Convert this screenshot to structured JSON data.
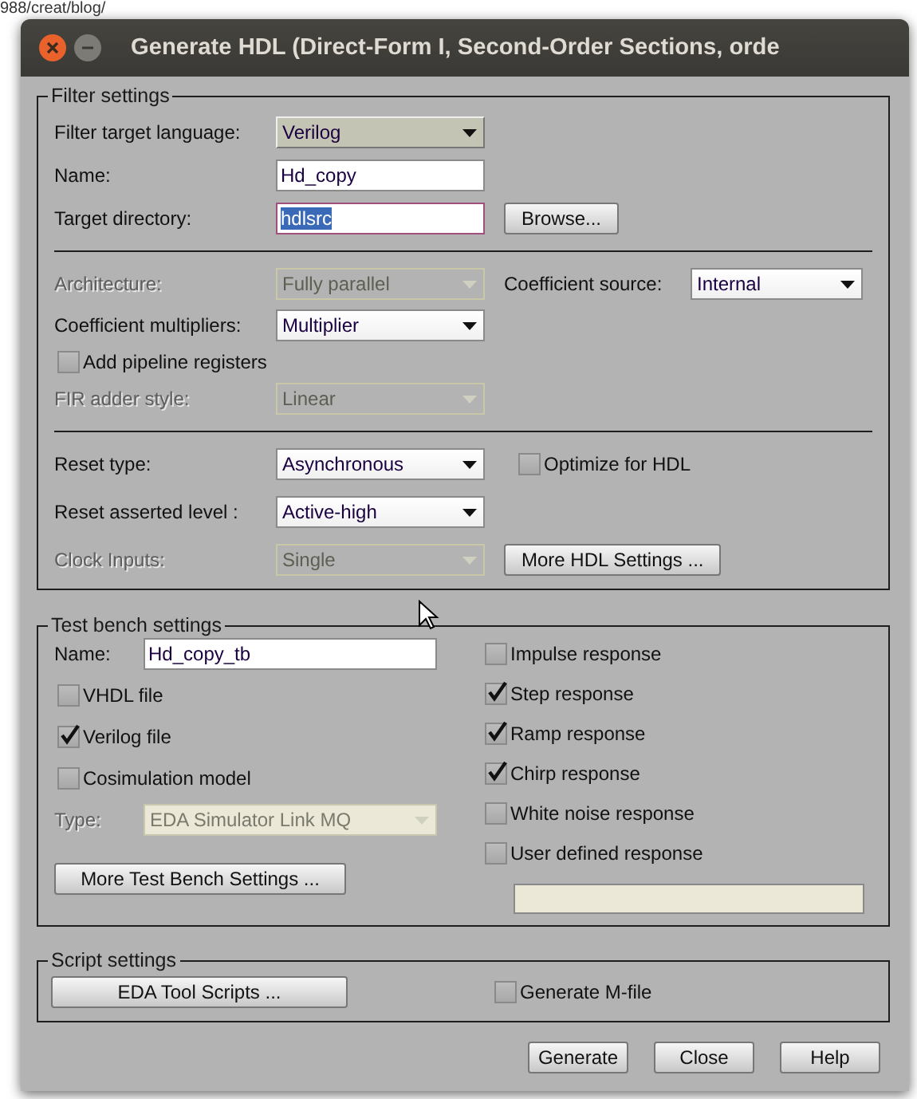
{
  "background": {
    "address_fragment": "988/creat/blog/"
  },
  "window": {
    "title": "Generate HDL (Direct-Form I, Second-Order Sections, orde"
  },
  "filter_settings": {
    "legend": "Filter settings",
    "sections": [
      {
        "rows": [
          {
            "items": [
              {
                "kind": "label",
                "text": "Filter target language:",
                "disabled": false
              },
              {
                "kind": "dropdown",
                "value": "Verilog",
                "disabled": false,
                "focused": true
              }
            ]
          },
          {
            "items": [
              {
                "kind": "label",
                "text": "Name:",
                "disabled": false
              },
              {
                "kind": "input",
                "value": "Hd_copy",
                "focused": false,
                "text_selected": false,
                "disabled": false
              }
            ]
          },
          {
            "items": [
              {
                "kind": "label",
                "text": "Target directory:",
                "disabled": false
              },
              {
                "kind": "input",
                "value": "hdlsrc",
                "focused": true,
                "text_selected": true,
                "disabled": false
              },
              {
                "kind": "button",
                "label": "Browse..."
              }
            ]
          }
        ]
      },
      {
        "rows": [
          {
            "items": [
              {
                "kind": "label",
                "text": "Architecture:",
                "disabled": true
              },
              {
                "kind": "dropdown",
                "value": "Fully parallel",
                "disabled": true,
                "focused": false
              },
              {
                "kind": "label",
                "text": "Coefficient source:",
                "disabled": false
              },
              {
                "kind": "dropdown",
                "value": "Internal",
                "disabled": false,
                "focused": false
              }
            ]
          },
          {
            "items": [
              {
                "kind": "label",
                "text": "Coefficient multipliers:",
                "disabled": false
              },
              {
                "kind": "dropdown",
                "value": "Multiplier",
                "disabled": false,
                "focused": false
              }
            ]
          },
          {
            "items": [
              {
                "kind": "checkbox",
                "label": "Add pipeline registers",
                "checked": false
              }
            ]
          },
          {
            "items": [
              {
                "kind": "label",
                "text": "FIR adder style:",
                "disabled": true
              },
              {
                "kind": "dropdown",
                "value": "Linear",
                "disabled": true,
                "focused": false
              }
            ]
          }
        ]
      },
      {
        "rows": [
          {
            "items": [
              {
                "kind": "label",
                "text": "Reset type:",
                "disabled": false
              },
              {
                "kind": "dropdown",
                "value": "Asynchronous",
                "disabled": false,
                "focused": false
              },
              {
                "kind": "checkbox",
                "label": "Optimize for HDL",
                "checked": false
              }
            ]
          },
          {
            "items": [
              {
                "kind": "label",
                "text": "Reset asserted level :",
                "disabled": false
              },
              {
                "kind": "dropdown",
                "value": "Active-high",
                "disabled": false,
                "focused": false
              }
            ]
          },
          {
            "items": [
              {
                "kind": "label",
                "text": "Clock Inputs:",
                "disabled": true
              },
              {
                "kind": "dropdown",
                "value": "Single",
                "disabled": true,
                "focused": false
              },
              {
                "kind": "button",
                "label": "More HDL Settings ..."
              }
            ]
          }
        ]
      }
    ]
  },
  "test_bench_settings": {
    "legend": "Test bench settings",
    "left": [
      {
        "items": [
          {
            "kind": "label",
            "text": "Name:",
            "disabled": false
          },
          {
            "kind": "input",
            "value": "Hd_copy_tb",
            "focused": false,
            "text_selected": false,
            "disabled": false
          }
        ]
      },
      {
        "items": [
          {
            "kind": "checkbox",
            "label": "VHDL file",
            "checked": false
          }
        ]
      },
      {
        "items": [
          {
            "kind": "checkbox",
            "label": "Verilog file",
            "checked": true
          }
        ]
      },
      {
        "items": [
          {
            "kind": "checkbox",
            "label": "Cosimulation model",
            "checked": false
          }
        ]
      },
      {
        "items": [
          {
            "kind": "label",
            "text": "Type:",
            "disabled": true
          },
          {
            "kind": "dropdown",
            "value": "EDA Simulator Link MQ",
            "disabled": true,
            "focused": false
          }
        ]
      },
      {
        "items": [
          {
            "kind": "button",
            "label": "More Test Bench Settings ..."
          }
        ]
      }
    ],
    "right": [
      {
        "items": [
          {
            "kind": "checkbox",
            "label": "Impulse response",
            "checked": false
          }
        ]
      },
      {
        "items": [
          {
            "kind": "checkbox",
            "label": "Step response",
            "checked": true
          }
        ]
      },
      {
        "items": [
          {
            "kind": "checkbox",
            "label": "Ramp response",
            "checked": true
          }
        ]
      },
      {
        "items": [
          {
            "kind": "checkbox",
            "label": "Chirp response",
            "checked": true
          }
        ]
      },
      {
        "items": [
          {
            "kind": "checkbox",
            "label": "White noise response",
            "checked": false
          }
        ]
      },
      {
        "items": [
          {
            "kind": "checkbox",
            "label": "User defined response",
            "checked": false
          }
        ]
      },
      {
        "items": [
          {
            "kind": "input",
            "disabled": true
          }
        ]
      }
    ]
  },
  "script_settings": {
    "legend": "Script settings",
    "items": [
      {
        "kind": "button",
        "label": "EDA Tool Scripts ..."
      },
      {
        "kind": "checkbox",
        "label": "Generate M-file",
        "checked": false
      }
    ]
  },
  "buttons": [
    {
      "label": "Generate"
    },
    {
      "label": "Close"
    },
    {
      "label": "Help"
    }
  ]
}
